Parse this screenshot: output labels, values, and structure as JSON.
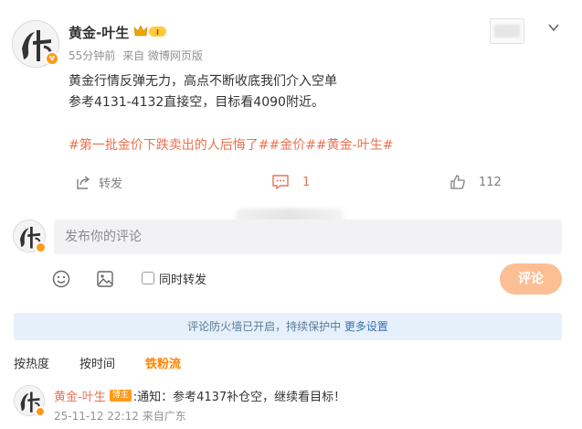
{
  "post": {
    "author": "黄金-叶生",
    "time": "55分钟前",
    "source": "来自 微博网页版",
    "content_lines": [
      "黄金行情反弹无力，高点不断收底我们介入空单",
      "参考4131-4132直接空，目标看4090附近。"
    ],
    "tags": "#第一批金价下跌卖出的人后悔了##金价##黄金-叶生#",
    "actions": {
      "share_label": "转发",
      "comment_count": "1",
      "like_count": "112"
    },
    "icons": {
      "crown": "vip-crown-icon",
      "chevron": "chevron-down-icon",
      "share": "share-icon",
      "comment": "comment-icon",
      "like": "like-icon"
    }
  },
  "composer": {
    "placeholder": "发布你的评论",
    "repost_label": "同时转发",
    "submit_label": "评论",
    "icons": {
      "emoji": "emoji-icon",
      "image": "image-icon"
    }
  },
  "notice": {
    "text": "评论防火墙已开启，持续保护中",
    "link": "更多设置"
  },
  "tabs": [
    "按热度",
    "按时间",
    "铁粉流"
  ],
  "comment": {
    "author": "黄金-叶生",
    "badge": "博主",
    "text": ":通知：参考4137补仓空，继续看目标！",
    "time": "25-11-12 22:12",
    "location": "来自广东"
  },
  "colors": {
    "accent": "#eb7350",
    "orange": "#ff8200",
    "submit_bg": "#fcbf94",
    "notice_bg": "#e5f0fb"
  }
}
